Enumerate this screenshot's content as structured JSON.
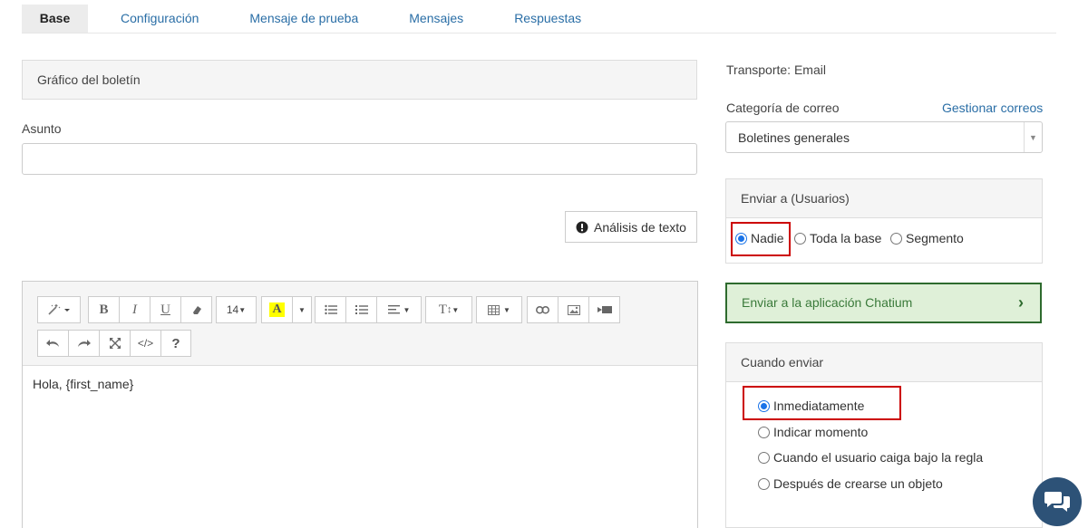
{
  "tabs": [
    {
      "label": "Base",
      "active": true
    },
    {
      "label": "Configuración"
    },
    {
      "label": "Mensaje de prueba"
    },
    {
      "label": "Mensajes"
    },
    {
      "label": "Respuestas"
    }
  ],
  "left": {
    "panel_title": "Gráfico del boletín",
    "subject_label": "Asunto",
    "subject_value": "",
    "text_analysis_button": "Análisis de texto",
    "editor": {
      "font_size": "14",
      "content": "Hola, {first_name}",
      "highlight_color": "#ffff00"
    }
  },
  "right": {
    "transport": "Transporte: Email",
    "mail_category_label": "Categoría de correo",
    "manage_mail_link": "Gestionar correos",
    "mail_category_value": "Boletines generales",
    "send_to": {
      "title": "Enviar a (Usuarios)",
      "options": [
        "Nadie",
        "Toda la base",
        "Segmento"
      ],
      "selected": "Nadie"
    },
    "chatium_button": "Enviar a la aplicación Chatium",
    "when_send": {
      "title": "Cuando enviar",
      "options": [
        "Inmediatamente",
        "Indicar momento",
        "Cuando el usuario caiga bajo la regla",
        "Después de crearse un objeto"
      ],
      "selected": "Inmediatamente"
    }
  },
  "colors": {
    "link": "#2a6ea6",
    "highlight_box": "#cc0000",
    "chatium_bg": "#dff0d8",
    "chatium_border": "#2e6b2e",
    "chat_bubble": "#2d5277"
  }
}
